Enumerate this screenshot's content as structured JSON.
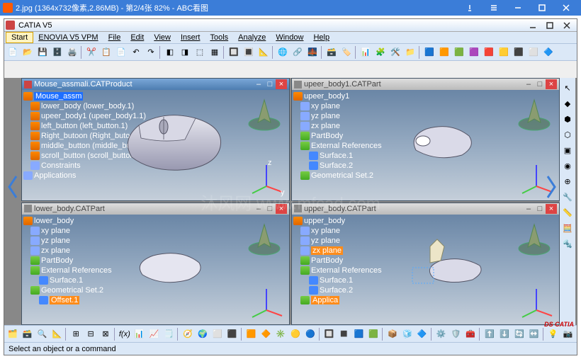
{
  "outer": {
    "title": "2.jpg  (1364x732像素,2.86MB) - 第2/4张 82% - ABC看图"
  },
  "catia": {
    "title": "CATIA V5"
  },
  "menu": {
    "start": "Start",
    "enovia": "ENOVIA V5 VPM",
    "file": "File",
    "edit": "Edit",
    "view": "View",
    "insert": "Insert",
    "tools": "Tools",
    "analyze": "Analyze",
    "window": "Window",
    "help": "Help"
  },
  "panes": {
    "tl": {
      "title": "Mouse_assmali.CATProduct",
      "tree": [
        "Mouse_assm",
        "lower_body (lower_body.1)",
        "upeer_body1 (upeer_body1.1)",
        "left_button (left_button.1)",
        "Right_butoon (Right_butoon.1)",
        "middle_button (middle_button.1)",
        "scroll_button (scroll_button.1)",
        "Constraints",
        "Applications"
      ]
    },
    "tr": {
      "title": "upeer_body1.CATPart",
      "tree": [
        "upeer_body1",
        "xy plane",
        "yz plane",
        "zx plane",
        "PartBody",
        "External References",
        "Surface.1",
        "Surface.2",
        "Geometrical Set.2"
      ]
    },
    "bl": {
      "title": "lower_body.CATPart",
      "tree": [
        "lower_body",
        "xy plane",
        "yz plane",
        "zx plane",
        "PartBody",
        "External References",
        "Surface.1",
        "Geometrical Set.2",
        "Offset.1"
      ]
    },
    "br": {
      "title": "upper_body.CATPart",
      "tree": [
        "upper_body",
        "xy plane",
        "yz plane",
        "zx plane",
        "PartBody",
        "External References",
        "Surface.1",
        "Surface.2",
        "Applica"
      ]
    }
  },
  "status": "Select an object or a command",
  "watermark": "沐风网\nwww.mfcad.com",
  "logo": "DS CATIA"
}
